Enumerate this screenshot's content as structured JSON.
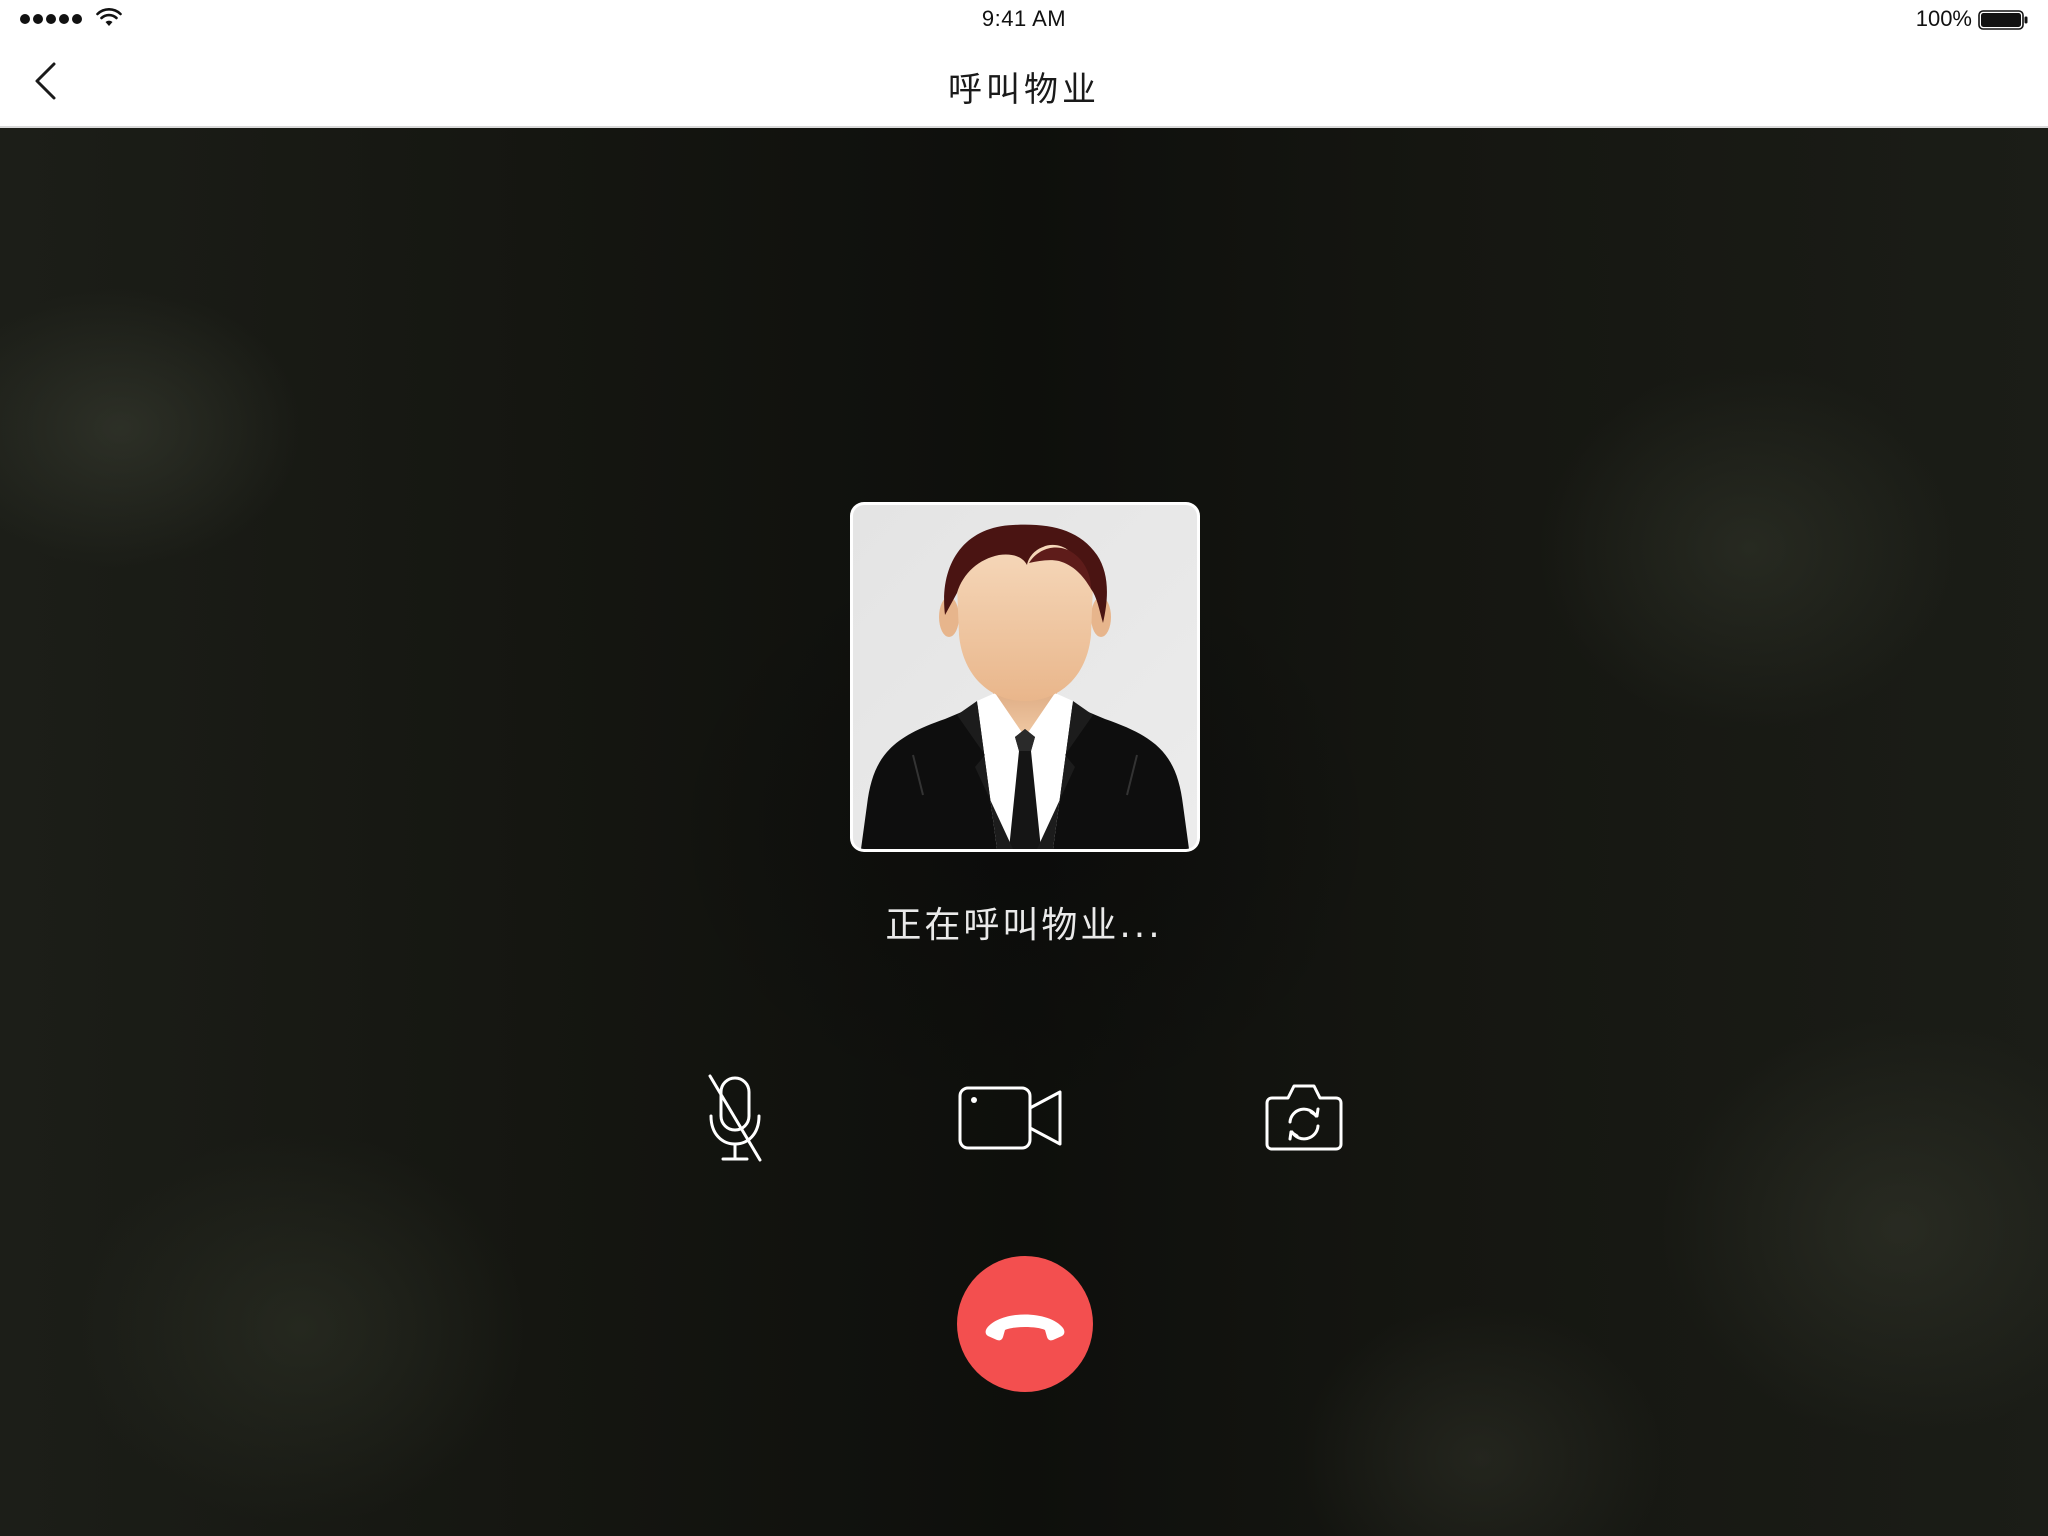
{
  "status_bar": {
    "time": "9:41 AM",
    "battery_percent": "100%",
    "signal_icon": "signal-dots-icon",
    "wifi_icon": "wifi-icon",
    "battery_icon": "battery-full-icon"
  },
  "nav": {
    "title": "呼叫物业",
    "back_icon": "chevron-left-icon"
  },
  "call": {
    "status_text": "正在呼叫物业...",
    "avatar_icon": "businessman-avatar",
    "controls": [
      {
        "name": "mute",
        "icon": "microphone-off-icon"
      },
      {
        "name": "video",
        "icon": "video-camera-icon"
      },
      {
        "name": "switch-camera",
        "icon": "camera-switch-icon"
      }
    ],
    "hangup_icon": "phone-hangup-icon"
  },
  "colors": {
    "hangup": "#f34f4f",
    "background": "#141511",
    "bar": "#ffffff"
  }
}
